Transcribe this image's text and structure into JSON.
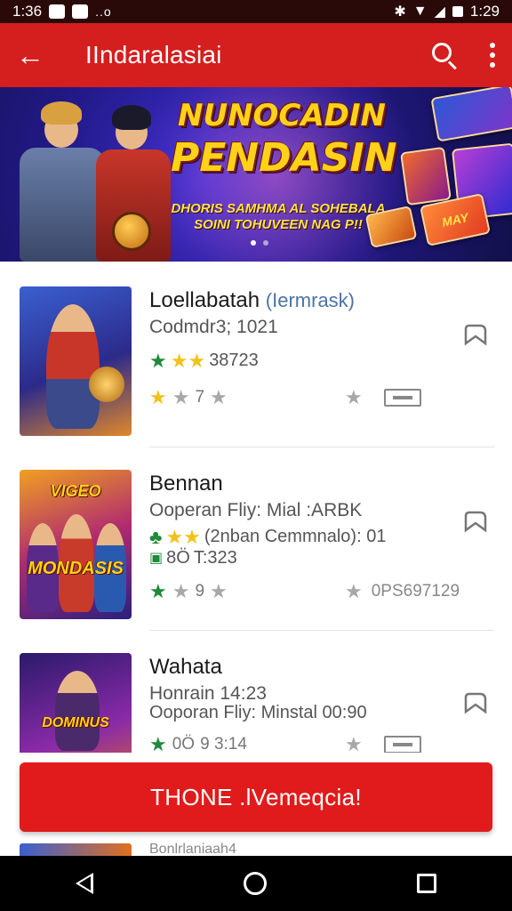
{
  "status_bar": {
    "time": "1:36",
    "right_time": "1:29",
    "icons": [
      "notification-icon",
      "photo-icon",
      "more-notifications-icon",
      "bluetooth-icon",
      "wifi-icon",
      "signal-icon",
      "battery-icon"
    ],
    "dots": "..o"
  },
  "app_bar": {
    "title": "IIndaralasiai",
    "back_icon": "arrow-left-icon",
    "search_icon": "search-icon",
    "menu_icon": "more-vertical-icon",
    "color": "#d51e1e"
  },
  "banner": {
    "headline_line1": "NUNOCADIN",
    "headline_line2": "PENDASIN",
    "subline_1": "DHORIS SAMHMA AL SOHEBALA",
    "subline_2": "SOINI TOHUVEEN NAG P!!",
    "card_text": "MAY",
    "page_indicator": {
      "total": 2,
      "active": 1
    }
  },
  "list": [
    {
      "title": "Loellabatah",
      "title_accent": "(Iermrask)",
      "subtitle": "Codmdr3; 1021",
      "rating_text": "38723",
      "stat_left": "7",
      "stat_right": "",
      "has_ticket": true
    },
    {
      "title": "Bennan",
      "subtitle": "Ooperan Fliy: Mial :ARBK",
      "detail_1": "(2nban Cemmnalo): 01",
      "detail_2": "T:323",
      "detail_2_prefix": "8Ö",
      "stat_left": "9",
      "stat_right": "0PS697129",
      "has_ticket": false
    },
    {
      "title": "Wahata",
      "subtitle": "Honrain 14:23",
      "detail_1": "Ooporan Fliy: Minstal 00:90",
      "stat_left_prefix": "0Ö",
      "stat_left": "9 3:14",
      "has_ticket": true
    }
  ],
  "cta": {
    "label": "THONE .lVemeqcia!",
    "color": "#e11b1b"
  },
  "peek_item": {
    "title": "Bonlrlaniaah4"
  },
  "nav_bar": {
    "back_icon": "nav-back-icon",
    "home_icon": "nav-home-icon",
    "recent_icon": "nav-recent-apps-icon"
  }
}
